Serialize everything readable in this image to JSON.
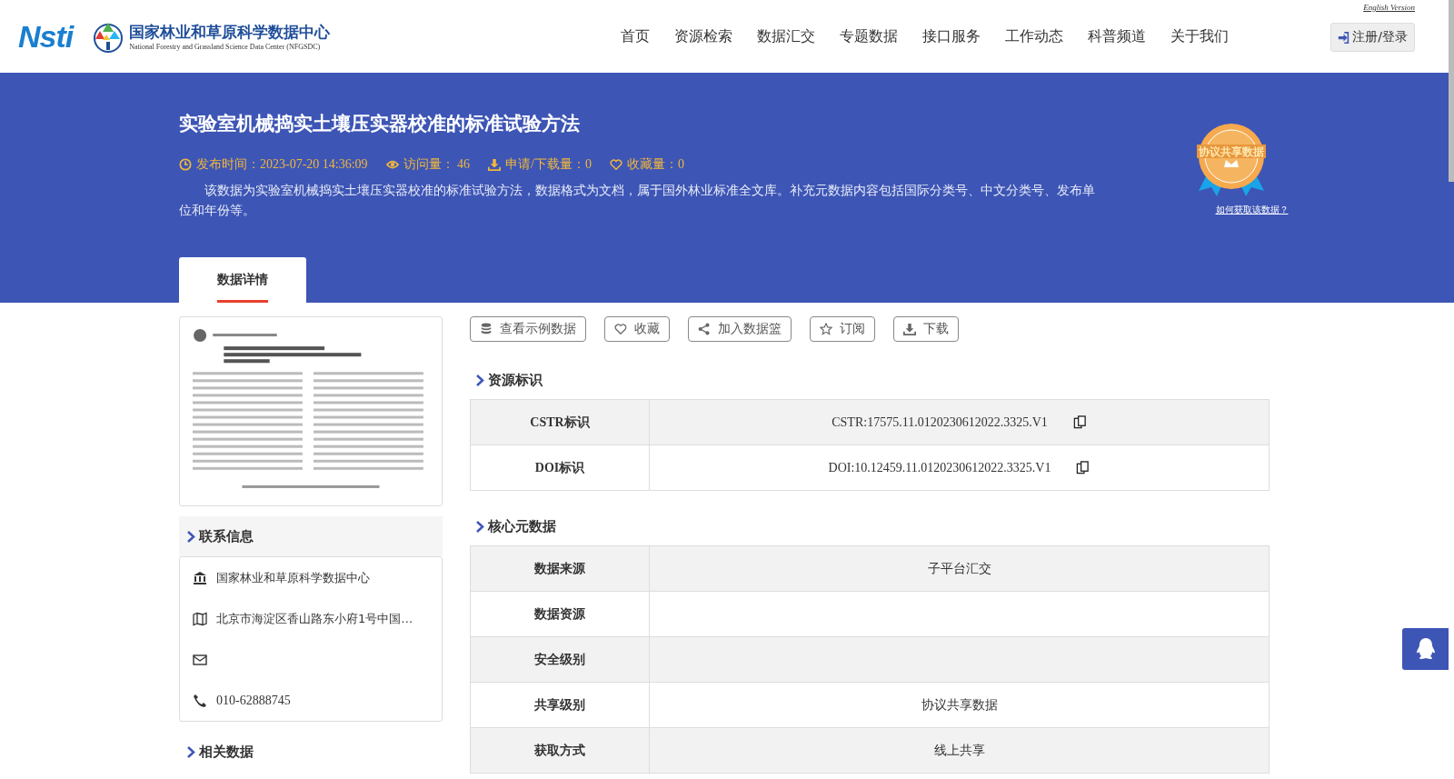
{
  "header": {
    "logo_text": "Nsti",
    "org_name": "国家林业和草原科学数据中心",
    "org_name_en": "National Forestry and Grassland Science Data Center (NFGSDC)",
    "english_link": "English Version",
    "nav": [
      {
        "label": "首页",
        "selected": false
      },
      {
        "label": "资源检索",
        "selected": false
      },
      {
        "label": "数据汇交",
        "selected": false
      },
      {
        "label": "专题数据",
        "selected": false
      },
      {
        "label": "接口服务",
        "selected": false
      },
      {
        "label": "工作动态",
        "selected": false
      },
      {
        "label": "科普频道",
        "selected": false
      },
      {
        "label": "关于我们",
        "selected": false
      }
    ],
    "login_button": "注册/登录"
  },
  "banner": {
    "title": "实验室机械捣实土壤压实器校准的标准试验方法",
    "meta": [
      {
        "kind": "time",
        "text": "发布时间：2023-07-20 14:36:09"
      },
      {
        "kind": "views",
        "text": "访问量： 46"
      },
      {
        "kind": "downloads",
        "text": "申请/下载量：0"
      },
      {
        "kind": "favorites",
        "text": "收藏量：0"
      }
    ],
    "description": "该数据为实验室机械捣实土壤压实器校准的标准试验方法，数据格式为文档，属于国外林业标准全文库。补充元数据内容包括国际分类号、中文分类号、发布单位和年份等。",
    "badge": "协议共享数据",
    "badge_link": "如何获取该数据？",
    "tabs": [
      {
        "label": "数据详情",
        "selected": true
      }
    ]
  },
  "sidebar": {
    "contact_title": "联系信息",
    "contacts": [
      {
        "kind": "org",
        "text": "国家林业和草原科学数据中心"
      },
      {
        "kind": "address",
        "text": "北京市海淀区香山路东小府1号中国…"
      },
      {
        "kind": "email"
      },
      {
        "kind": "phone",
        "text": "010-62888745"
      }
    ],
    "related_title": "相关数据"
  },
  "actions": [
    {
      "kind": "sample",
      "label": "查看示例数据"
    },
    {
      "kind": "favorite",
      "label": "收藏"
    },
    {
      "kind": "basket",
      "label": "加入数据篮"
    },
    {
      "kind": "subscribe",
      "label": "订阅"
    },
    {
      "kind": "download",
      "label": "下载"
    }
  ],
  "sections": [
    {
      "title": "资源标识",
      "rows": [
        {
          "label": "CSTR标识",
          "value": "CSTR:17575.11.0120230612022.3325.V1",
          "copy": true
        },
        {
          "label": "DOI标识",
          "value": "DOI:10.12459.11.0120230612022.3325.V1",
          "copy": true
        }
      ]
    },
    {
      "title": "核心元数据",
      "rows": [
        {
          "label": "数据来源",
          "value": "子平台汇交"
        },
        {
          "label": "数据资源"
        },
        {
          "label": "安全级别"
        },
        {
          "label": "共享级别",
          "value": "协议共享数据"
        },
        {
          "label": "获取方式",
          "value": "线上共享"
        }
      ]
    }
  ]
}
